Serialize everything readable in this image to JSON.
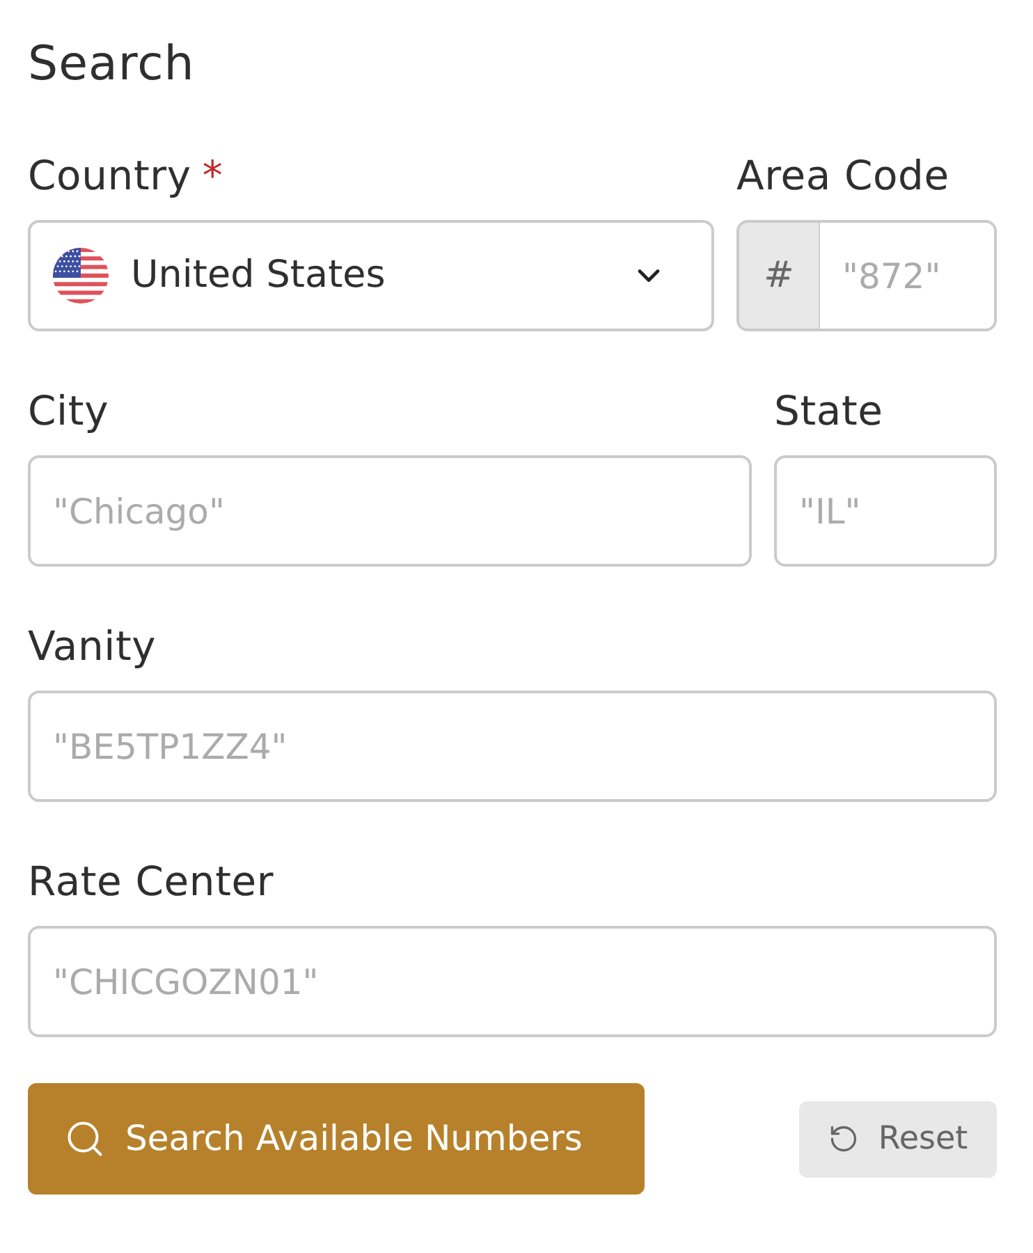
{
  "title": "Search",
  "rows": [
    [
      {
        "kind": "select",
        "label": "Country",
        "required_mark": "*",
        "value": "United States"
      },
      {
        "kind": "prefixed",
        "label": "Area Code",
        "prefix": "#",
        "placeholder": "\"872\""
      }
    ],
    [
      {
        "kind": "text",
        "label": "City",
        "placeholder": "\"Chicago\""
      },
      {
        "kind": "text",
        "label": "State",
        "placeholder": "\"IL\""
      }
    ],
    [
      {
        "kind": "text",
        "label": "Vanity",
        "placeholder": "\"BE5TP1ZZ4\""
      }
    ],
    [
      {
        "kind": "text",
        "label": "Rate Center",
        "placeholder": "\"CHICGOZN01\""
      }
    ]
  ],
  "buttons": [
    {
      "kind": "primary",
      "label": "Search Available Numbers"
    },
    {
      "kind": "secondary",
      "label": "Reset"
    }
  ]
}
